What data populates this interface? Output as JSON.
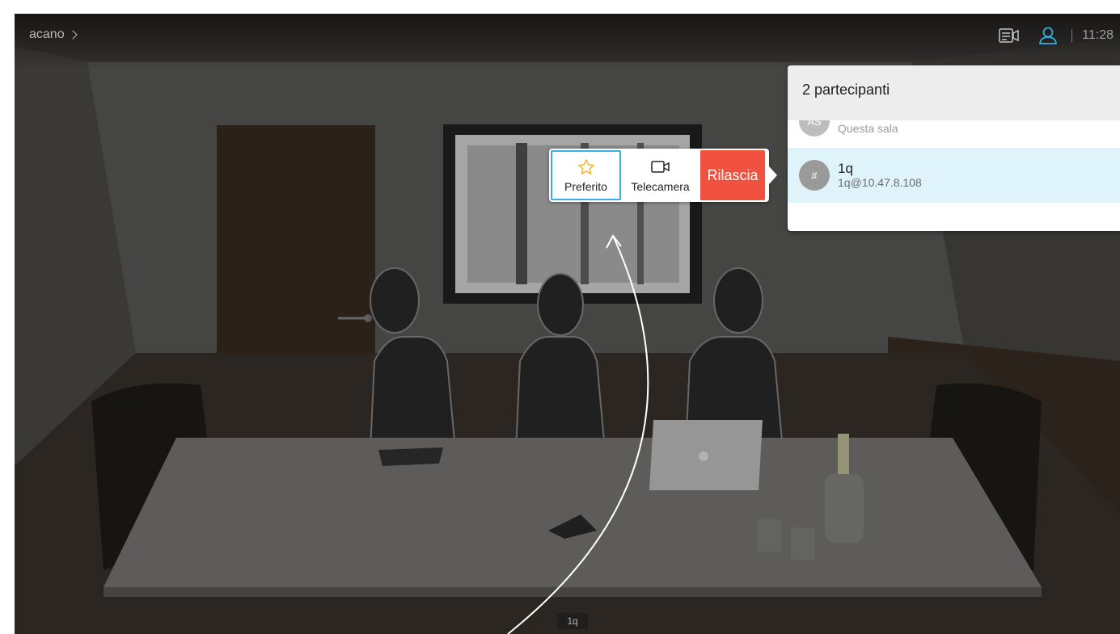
{
  "header": {
    "breadcrumb": "acano",
    "icons": [
      "layout-icon",
      "participants-icon"
    ],
    "time": "11:28"
  },
  "participants_panel": {
    "title": "2 partecipanti",
    "items": [
      {
        "avatar_text": "AS",
        "name": "",
        "subtitle": "Questa sala",
        "selected": false
      },
      {
        "avatar_text": "#",
        "name": "1q",
        "subtitle": "1q@10.47.8.108",
        "selected": true
      }
    ]
  },
  "popover": {
    "favorite_label": "Preferito",
    "favorite_icon": "star-icon",
    "camera_label": "Telecamera",
    "camera_icon": "camera-icon",
    "release_label": "Rilascia"
  },
  "video": {
    "name_label": "1q"
  },
  "colors": {
    "accent": "#3ab0e2",
    "release": "#f0523f",
    "selected_row": "#dff3fb",
    "favorite_star": "#f0b21e"
  }
}
